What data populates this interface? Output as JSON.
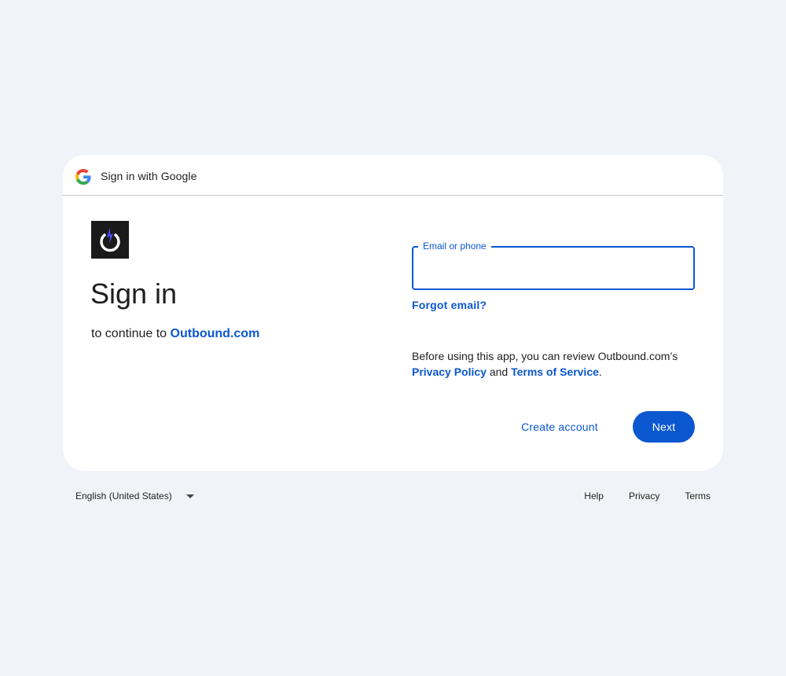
{
  "header": {
    "title": "Sign in with Google",
    "logo_icon": "google-g-icon"
  },
  "app": {
    "logo_icon": "power-bolt-icon",
    "logo_bg": "#1a1a1a",
    "logo_accent": "#4a4dff"
  },
  "main": {
    "title": "Sign in",
    "continue_prefix": "to continue to",
    "continue_app": "Outbound.com"
  },
  "form": {
    "email_label": "Email or phone",
    "email_value": "",
    "forgot_email": "Forgot email?",
    "notice_prefix": "Before using this app, you can review Outbound.com’s",
    "privacy_policy": "Privacy Policy",
    "and": "and",
    "terms_of_service": "Terms of Service",
    "period": "."
  },
  "actions": {
    "create_account": "Create account",
    "next": "Next"
  },
  "footer": {
    "language": "English (United States)",
    "help": "Help",
    "privacy": "Privacy",
    "terms": "Terms"
  },
  "colors": {
    "accent": "#0b57d0",
    "background": "#f0f4f9",
    "card": "#ffffff"
  }
}
